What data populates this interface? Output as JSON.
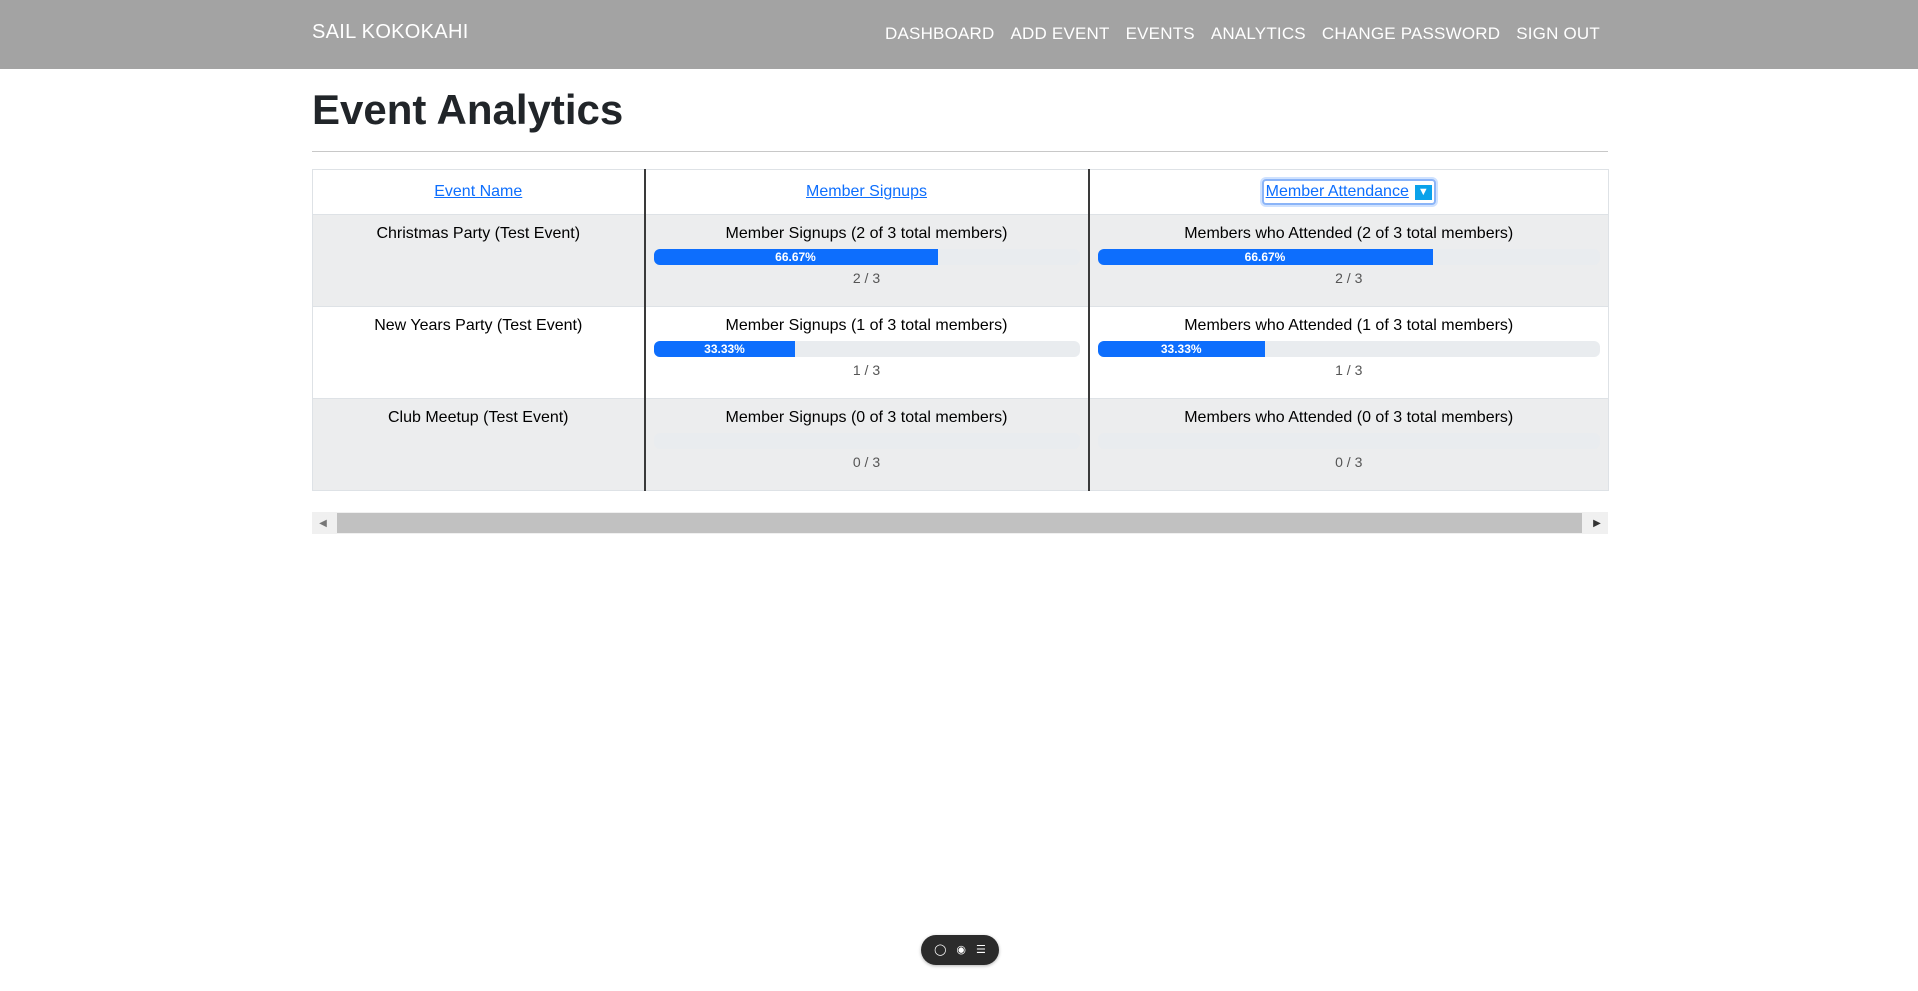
{
  "nav": {
    "brand": "SAIL KOKOKAHI",
    "links": [
      "DASHBOARD",
      "ADD EVENT",
      "EVENTS",
      "ANALYTICS",
      "CHANGE PASSWORD",
      "SIGN OUT"
    ]
  },
  "page": {
    "title": "Event Analytics"
  },
  "table": {
    "headers": [
      "Event Name",
      "Member Signups",
      "Member Attendance"
    ],
    "sort_icon": "sort-desc-icon",
    "rows": [
      {
        "name": "Christmas Party (Test Event)",
        "signups_label": "Member Signups (2 of 3 total members)",
        "signups_percent": 66.67,
        "signups_percent_text": "66.67%",
        "signups_count": "2 / 3",
        "attendance_label": "Members who Attended (2 of 3 total members)",
        "attendance_percent": 66.67,
        "attendance_percent_text": "66.67%",
        "attendance_count": "2 / 3"
      },
      {
        "name": "New Years Party (Test Event)",
        "signups_label": "Member Signups (1 of 3 total members)",
        "signups_percent": 33.33,
        "signups_percent_text": "33.33%",
        "signups_count": "1 / 3",
        "attendance_label": "Members who Attended (1 of 3 total members)",
        "attendance_percent": 33.33,
        "attendance_percent_text": "33.33%",
        "attendance_count": "1 / 3"
      },
      {
        "name": "Club Meetup (Test Event)",
        "signups_label": "Member Signups (0 of 3 total members)",
        "signups_percent": 0,
        "signups_percent_text": "",
        "signups_count": "0 / 3",
        "attendance_label": "Members who Attended (0 of 3 total members)",
        "attendance_percent": 0,
        "attendance_percent_text": "",
        "attendance_count": "0 / 3"
      }
    ]
  },
  "colors": {
    "navbar": "#a3a3a3",
    "progress": "#0d6efd",
    "link": "#0d6efd",
    "sort_icon": "#0aa2ea"
  },
  "toolbar_icons": [
    "chat-icon",
    "toggle-icon",
    "menu-icon"
  ]
}
